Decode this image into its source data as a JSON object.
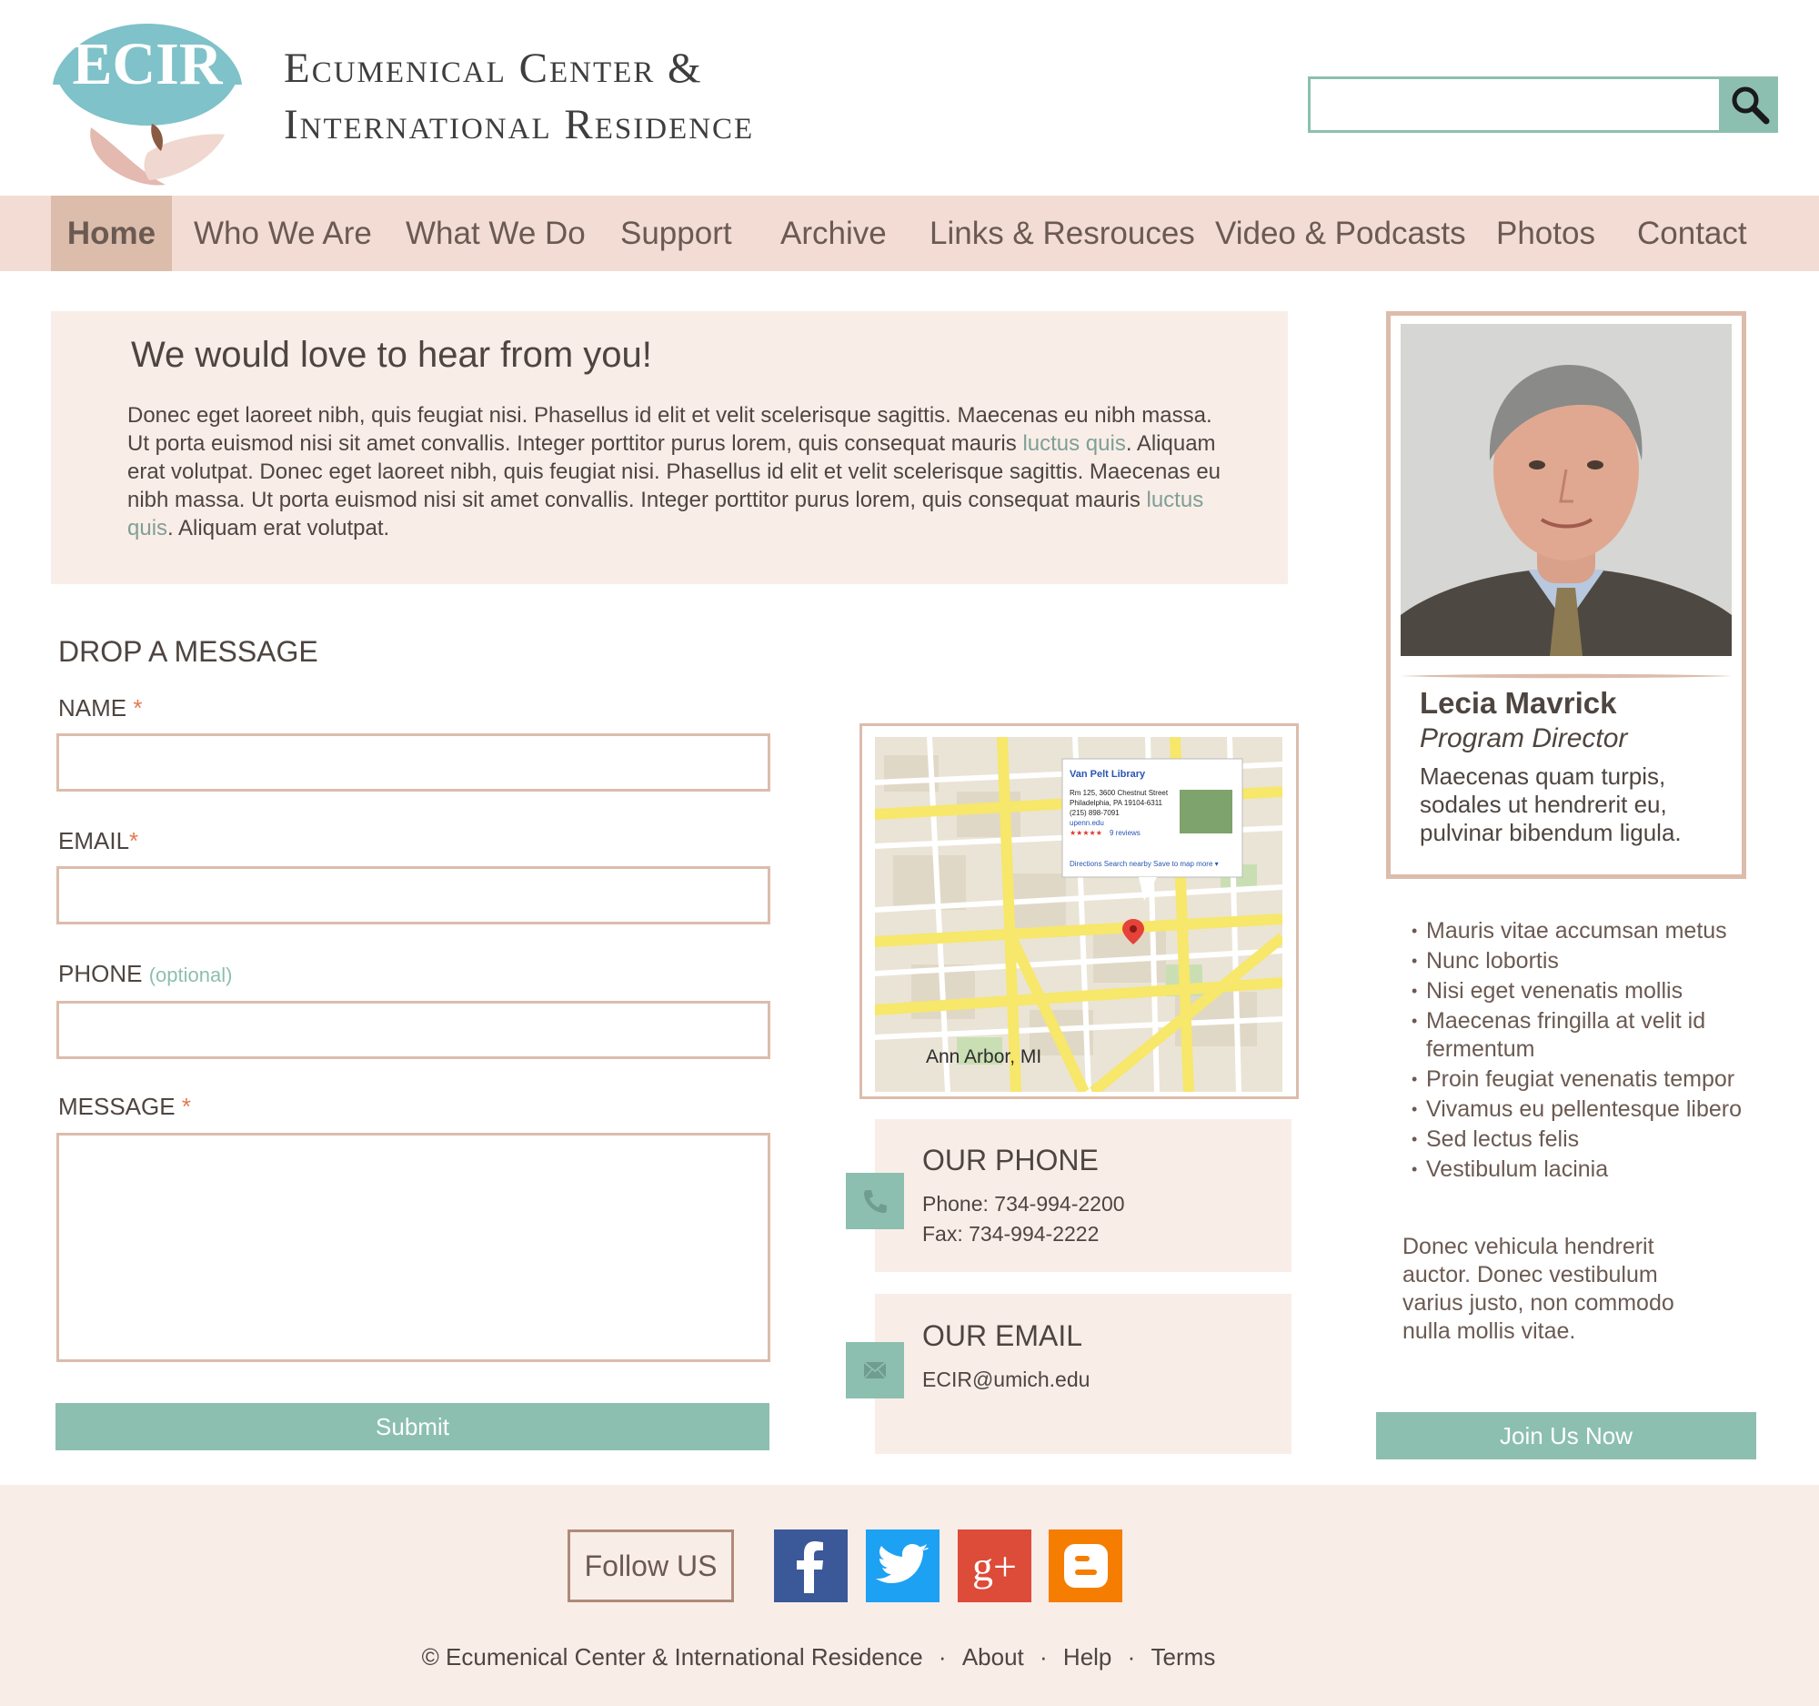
{
  "brand": {
    "logo_text": "ECIR",
    "title_line1": "Ecumenical Center &",
    "title_line2": "International Residence"
  },
  "search": {
    "placeholder": "",
    "button_icon": "search-icon"
  },
  "nav": {
    "items": [
      {
        "label": "Home",
        "active": true
      },
      {
        "label": "Who We Are"
      },
      {
        "label": "What We Do"
      },
      {
        "label": "Support"
      },
      {
        "label": "Archive"
      },
      {
        "label": "Links & Resrouces"
      },
      {
        "label": "Video & Podcasts"
      },
      {
        "label": "Photos"
      },
      {
        "label": "Contact"
      }
    ]
  },
  "intro": {
    "title": "We would love to hear from you!",
    "body_1": "Donec eget laoreet nibh, quis feugiat nisi. Phasellus id elit et velit scelerisque sagittis. Maecenas eu nibh massa. Ut porta euismod nisi sit amet convallis. Integer porttitor purus lorem, quis consequat mauris ",
    "body_hl1": "luctus quis",
    "body_2": ". Aliquam erat volutpat. Donec eget laoreet nibh, quis feugiat nisi. Phasellus id elit et velit scelerisque sagittis. Maecenas eu nibh massa. Ut porta euismod nisi sit amet convallis. Integer porttitor purus lorem, quis consequat mauris ",
    "body_hl2": "luctus quis",
    "body_3": ". Aliquam erat volutpat."
  },
  "form": {
    "title": "DROP A MESSAGE",
    "name_label": "NAME",
    "email_label": "EMAIL",
    "phone_label": "PHONE",
    "phone_optional": "(optional)",
    "message_label": "MESSAGE",
    "required_mark": "*",
    "submit_label": "Submit"
  },
  "map": {
    "caption": "Ann Arbor, MI",
    "popup_title": "Van Pelt Library",
    "popup_line1": "Rm 125, 3600 Chestnut Street",
    "popup_line2": "Philadelphia, PA 19104-6311",
    "popup_line3": "(215) 898-7091",
    "popup_line4": "upenn.edu",
    "popup_reviews": "9 reviews",
    "popup_actions": "Directions   Search nearby   Save to map   more ▾"
  },
  "contact": {
    "phone_title": "OUR PHONE",
    "phone": "Phone: 734-994-2200",
    "fax": "Fax: 734-994-2222",
    "email_title": "OUR EMAIL",
    "email": "ECIR@umich.edu"
  },
  "profile": {
    "name": "Lecia Mavrick",
    "role": "Program Director",
    "description": "Maecenas quam turpis, sodales ut hendrerit eu, pulvinar bibendum ligula."
  },
  "side_list": [
    "Mauris vitae accumsan metus",
    "Nunc lobortis",
    "Nisi eget venenatis mollis",
    "Maecenas fringilla at velit id fermentum",
    "Proin feugiat venenatis tempor",
    "Vivamus eu pellentesque libero",
    "Sed lectus felis",
    "Vestibulum lacinia"
  ],
  "side_paragraph": "Donec vehicula hendrerit auctor. Donec vestibulum varius justo, non commodo nulla mollis vitae.",
  "join_label": "Join Us Now",
  "footer": {
    "follow_label": "Follow US",
    "copyright": "© Ecumenical Center & International Residence",
    "separator": "·",
    "about": "About",
    "help": "Help",
    "terms": "Terms",
    "social": [
      {
        "name": "facebook",
        "glyph": "f",
        "color": "#3b5998"
      },
      {
        "name": "twitter",
        "color": "#1da1f2"
      },
      {
        "name": "google-plus",
        "glyph": "g+",
        "color": "#dd4b39"
      },
      {
        "name": "blogger",
        "color": "#f57d00"
      }
    ]
  },
  "colors": {
    "accent": "#8cbfb0",
    "nav_bg": "#f2dcd3",
    "nav_active": "#dcbcab",
    "panel_bg": "#f9ede8",
    "border": "#dcbcab",
    "required": "#e07b4f"
  }
}
